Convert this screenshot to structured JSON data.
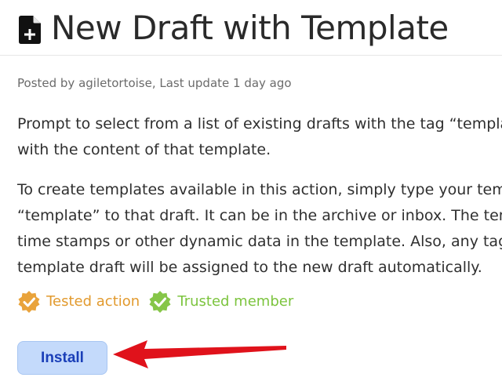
{
  "header": {
    "icon": "new-document-icon",
    "title": "New Draft with Template"
  },
  "meta": {
    "byline": "Posted by agiletortoise, Last update 1 day ago"
  },
  "description": {
    "paragraph1": [
      "Prompt to select from a list of existing drafts with the tag “template”",
      "with the content of that template."
    ],
    "paragraph2": [
      "To create templates available in this action, simply type your template",
      "“template” to that draft. It can be in the archive or inbox. The templat",
      "time stamps or other dynamic data in the template. Also, any tags oth",
      "template draft will be assigned to the new draft automatically."
    ]
  },
  "badges": {
    "tested": {
      "icon": "tested-check-badge-icon",
      "label": "Tested action",
      "color": "#e29a2e"
    },
    "trusted": {
      "icon": "trusted-check-badge-icon",
      "label": "Trusted member",
      "color": "#7cc43e"
    }
  },
  "actions": {
    "install_label": "Install",
    "annotation_icon": "red-arrow-icon"
  },
  "colors": {
    "button_bg": "#c4dafb",
    "button_text": "#1a3fb8",
    "arrow": "#e0121b"
  }
}
